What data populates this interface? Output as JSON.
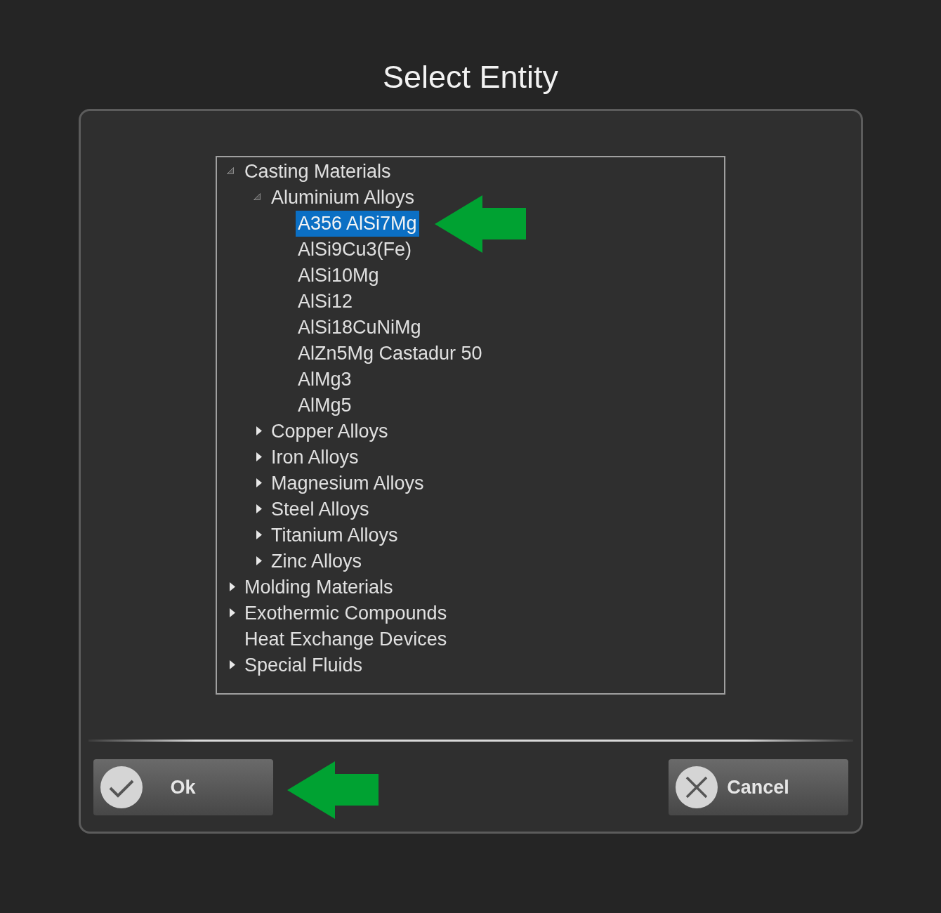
{
  "window": {
    "title": "Select Entity"
  },
  "tree": [
    {
      "label": "Casting Materials",
      "expanded": true,
      "selected": false,
      "children": [
        {
          "label": "Aluminium Alloys",
          "expanded": true,
          "selected": false,
          "children": [
            {
              "label": "A356 AlSi7Mg",
              "selected": true
            },
            {
              "label": "AlSi9Cu3(Fe)",
              "selected": false
            },
            {
              "label": "AlSi10Mg",
              "selected": false
            },
            {
              "label": "AlSi12",
              "selected": false
            },
            {
              "label": "AlSi18CuNiMg",
              "selected": false
            },
            {
              "label": "AlZn5Mg Castadur 50",
              "selected": false
            },
            {
              "label": "AlMg3",
              "selected": false
            },
            {
              "label": "AlMg5",
              "selected": false
            }
          ]
        },
        {
          "label": "Copper Alloys",
          "expanded": false,
          "selected": false
        },
        {
          "label": "Iron Alloys",
          "expanded": false,
          "selected": false
        },
        {
          "label": "Magnesium Alloys",
          "expanded": false,
          "selected": false
        },
        {
          "label": "Steel Alloys",
          "expanded": false,
          "selected": false
        },
        {
          "label": "Titanium Alloys",
          "expanded": false,
          "selected": false
        },
        {
          "label": "Zinc Alloys",
          "expanded": false,
          "selected": false
        }
      ]
    },
    {
      "label": "Molding Materials",
      "expanded": false,
      "selected": false
    },
    {
      "label": "Exothermic Compounds",
      "expanded": false,
      "selected": false
    },
    {
      "label": "Heat Exchange Devices",
      "selected": false
    },
    {
      "label": "Special Fluids",
      "expanded": false,
      "selected": false
    }
  ],
  "buttons": [
    {
      "label": "Ok",
      "kind": "ok"
    },
    {
      "label": "Cancel",
      "kind": "cancel"
    }
  ]
}
